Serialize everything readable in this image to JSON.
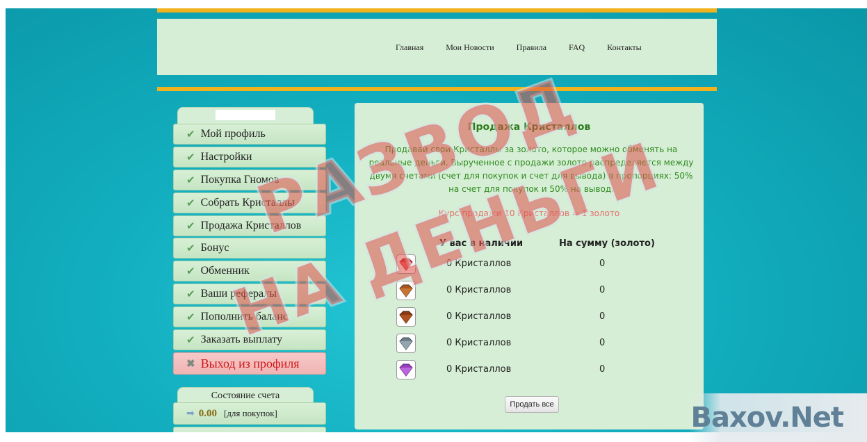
{
  "nav": {
    "items": [
      "Главная",
      "Мои Новости",
      "Правила",
      "FAQ",
      "Контакты"
    ]
  },
  "sidebar": {
    "menu": [
      "Мой профиль",
      "Настройки",
      "Покупка Гномов",
      "Собрать Кристаллы",
      "Продажа Кристаллов",
      "Бонус",
      "Обменник",
      "Ваши рефералы",
      "Пополнить баланс",
      "Заказать выплату"
    ],
    "logout": "Выход из профиля",
    "account_title": "Состояние счета",
    "balance_value": "0.00",
    "balance_label": "[для покупок]"
  },
  "main": {
    "title": "Продажа Кристаллов",
    "description": "Продавай свои Кристаллы за золото, которое можно обменять на реальные деньги. Вырученное с продажи золото распределяется между двумя счетами (счет для покупок и счет для вывода) в пропорциях: 50% на счет для покупок и 50% на вывод.",
    "rate": "Курс продажи 10 Кристаллов = 1 золото",
    "col_have": "У вас в наличии",
    "col_sum": "На сумму (золото)",
    "gems": [
      {
        "qty": "0 Кристаллов",
        "sum": "0",
        "color": "#e0252d"
      },
      {
        "qty": "0 Кристаллов",
        "sum": "0",
        "color": "#a9561f"
      },
      {
        "qty": "0 Кристаллов",
        "sum": "0",
        "color": "#8c3a14"
      },
      {
        "qty": "0 Кристаллов",
        "sum": "0",
        "color": "#6f7f8a"
      },
      {
        "qty": "0 Кристаллов",
        "sum": "0",
        "color": "#9b3fc2"
      }
    ],
    "sell_all": "Продать все"
  },
  "watermark": {
    "line1": "РАЗВОД",
    "line2": "НА ДЕНЬГИ",
    "corner": "Baxov.Net"
  },
  "colors": {
    "accent_stripe": "#f2b21d",
    "panel_bg": "#d6eed5",
    "title_green": "#2f7a1f",
    "logout_red": "#d01818"
  }
}
